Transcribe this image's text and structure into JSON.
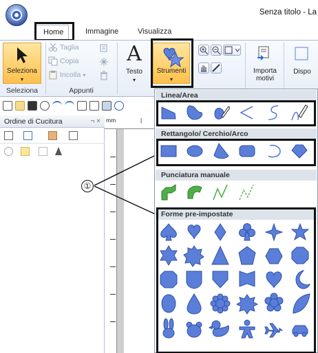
{
  "window": {
    "title": "Senza titolo - La"
  },
  "tabs": [
    {
      "label": "Home"
    },
    {
      "label": "Immagine"
    },
    {
      "label": "Visualizza"
    }
  ],
  "ribbon": {
    "seleziona_btn": "Seleziona",
    "seleziona_group": "Seleziona",
    "taglia": "Taglia",
    "copia": "Copia",
    "incolla": "Incolla",
    "appunti_group": "Appunti",
    "testo_btn": "Testo",
    "testo_letter": "A",
    "strumenti_btn": "Strumenti",
    "importa_btn": "Importa motivi",
    "dispo_btn": "Dispo"
  },
  "dropdown": {
    "sections": [
      {
        "title": "Linea/Area"
      },
      {
        "title": "Rettangolo/ Cerchio/Arco"
      },
      {
        "title": "Punciatura manuale"
      },
      {
        "title": "Forme pre-impostate"
      }
    ]
  },
  "pane": {
    "title": "Ordine di Cucitura",
    "controls": "¬ ×"
  },
  "ruler": {
    "unit": "mm"
  },
  "callout": {
    "number": "①"
  },
  "colors": {
    "accent": "#5b7fd9",
    "selected": "#ffc04a"
  }
}
